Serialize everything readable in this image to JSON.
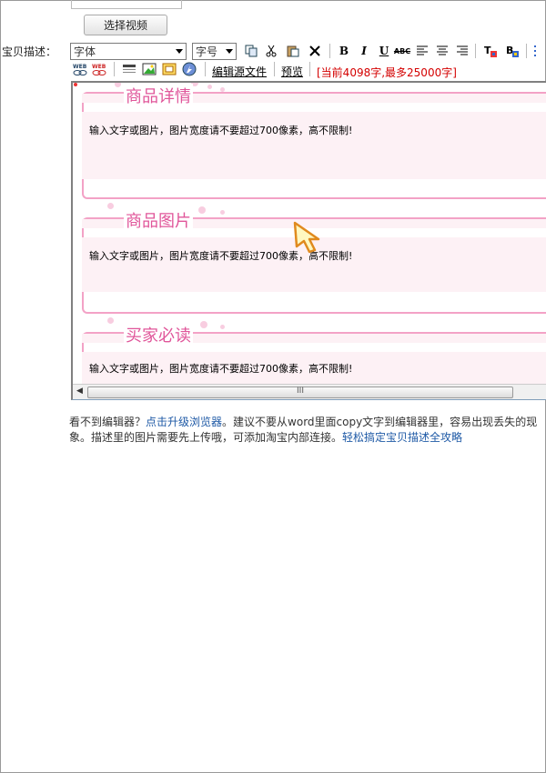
{
  "upload": {
    "select_video_label": "选择视频"
  },
  "form": {
    "desc_label": "宝贝描述："
  },
  "toolbar": {
    "font_select": "字体",
    "size_select": "字号",
    "bold_label": "B",
    "italic_label": "I",
    "underline_label": "U",
    "strike_label": "ABC",
    "edit_source_label": "编辑源文件",
    "preview_label": "预览",
    "counter_text": "[当前4098字,最多25000字]"
  },
  "editor": {
    "sections": [
      {
        "title": "商品详情",
        "hint": "输入文字或图片，图片宽度请不要超过700像素，高不限制!"
      },
      {
        "title": "商品图片",
        "hint": "输入文字或图片，图片宽度请不要超过700像素，高不限制!"
      },
      {
        "title": "买家必读",
        "hint": "输入文字或图片，图片宽度请不要超过700像素，高不限制!"
      }
    ],
    "scroll_grip": "III"
  },
  "footer": {
    "prefix": "看不到编辑器？",
    "upgrade_link": "点击升级浏览器",
    "middle": "。建议不要从word里面copy文字到编辑器里，容易出现丢失的现象。描述里的图片需要先上传哦，可添加淘宝内部连接。",
    "guide_link": "轻松搞定宝贝描述全攻略"
  },
  "colors": {
    "accent_pink": "#e0569a",
    "counter_red": "#d40000",
    "link_blue": "#1f5aa6"
  }
}
